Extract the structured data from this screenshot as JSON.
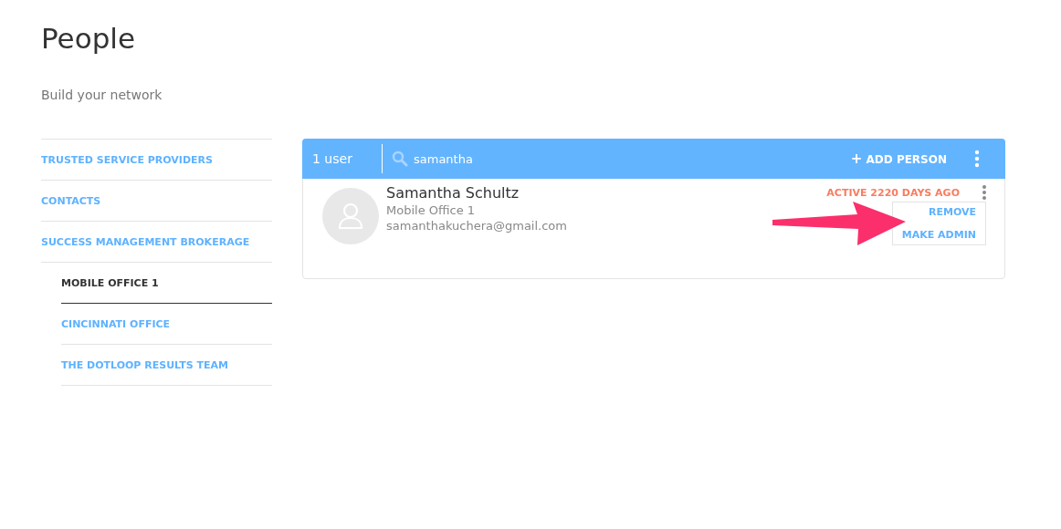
{
  "page": {
    "title": "People",
    "subtitle": "Build your network"
  },
  "sidebar": {
    "items": [
      {
        "label": "TRUSTED SERVICE PROVIDERS",
        "selected": false
      },
      {
        "label": "CONTACTS",
        "selected": false
      },
      {
        "label": "SUCCESS MANAGEMENT BROKERAGE",
        "selected": false,
        "children": [
          {
            "label": "MOBILE OFFICE 1",
            "selected": true
          },
          {
            "label": "CINCINNATI OFFICE",
            "selected": false
          },
          {
            "label": "THE DOTLOOP RESULTS TEAM",
            "selected": false
          }
        ]
      }
    ]
  },
  "toolbar": {
    "count": "1 user",
    "search": {
      "value": "samantha"
    },
    "add_button": "ADD PERSON",
    "add_icon": "+"
  },
  "people": [
    {
      "name": "Samantha Schultz",
      "office": "Mobile Office 1",
      "email": "samanthakuchera@gmail.com",
      "activity": "ACTIVE 2220 DAYS AGO",
      "menu": [
        "REMOVE",
        "MAKE ADMIN"
      ]
    }
  ]
}
